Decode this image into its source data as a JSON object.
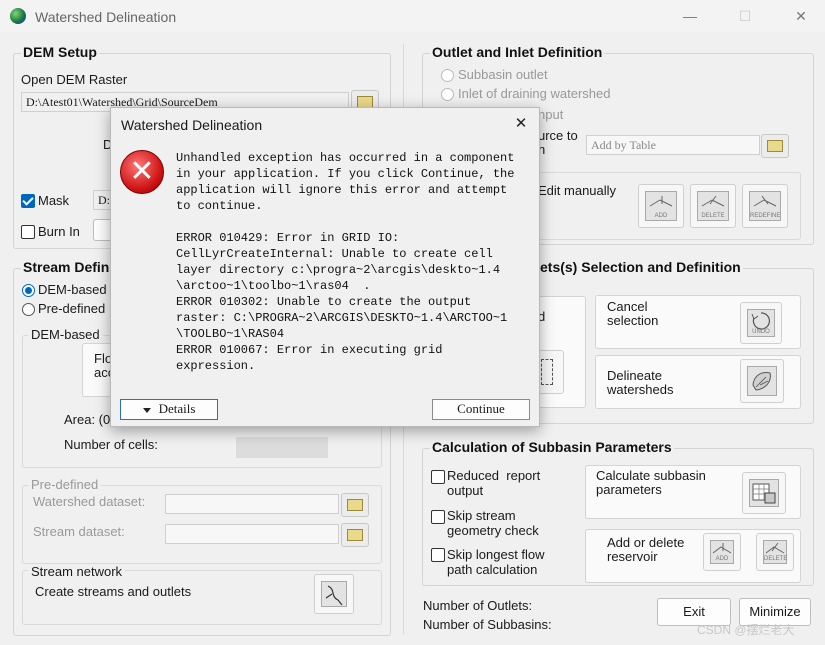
{
  "window": {
    "title": "Watershed Delineation",
    "minimize": "—",
    "maximize": "☐",
    "close": "✕"
  },
  "dem_setup": {
    "header": "DEM Setup",
    "open_dem_label": "Open DEM Raster",
    "dem_path": "D:\\Atest01\\Watershed\\Grid\\SourceDem",
    "partial_label": "D",
    "mask_label": "Mask",
    "mask_checked": true,
    "mask_value": "D:",
    "burn_in_label": "Burn In"
  },
  "stream_definition": {
    "header": "Stream Defin",
    "dem_based_radio": "DEM-based",
    "pre_defined_radio": "Pre-defined",
    "dem_group_label": "DEM-based",
    "flow_acc_partial": "Flo\nacc",
    "area_label": "Area: (0",
    "cells_label": "Number of cells:",
    "predefined_group_label": "Pre-defined",
    "watershed_dataset_label": "Watershed dataset:",
    "stream_dataset_label": "Stream dataset:",
    "stream_network_label": "Stream network",
    "create_streams_label": "Create streams and outlets"
  },
  "outlet": {
    "header": "Outlet and Inlet Definition",
    "subbasin_outlet": "Subbasin outlet",
    "inlet_draining": "Inlet of draining watershed",
    "partial_nput": "nput",
    "source_to_partial": "urce to\nn",
    "add_by_table_placeholder": "Add by Table",
    "edit_manually_partial": "Edit manually",
    "add_label": "ADD",
    "delete_label": "DELETE",
    "redefine_label": "REDEFINE"
  },
  "outlets_selection": {
    "header_partial": "ets(s) Selection and Definition",
    "partial_d": "d",
    "cancel_selection": "Cancel\nselection",
    "undo_label": "UNDO",
    "delineate_watersheds": "Delineate\nwatersheds"
  },
  "calc": {
    "header": "Calculation of Subbasin Parameters",
    "reduced_report": "Reduced  report\noutput",
    "skip_stream": "Skip stream\ngeometry check",
    "skip_longest": "Skip longest flow\npath calculation",
    "calculate_btn": "Calculate subbasin\nparameters",
    "add_delete_reservoir": "Add or delete\nreservoir",
    "add_label": "ADD",
    "delete_label": "DELETE"
  },
  "footer": {
    "outlets_label": "Number of Outlets:",
    "subbasins_label": "Number of Subbasins:",
    "exit_btn": "Exit",
    "minimize_btn": "Minimize",
    "watermark": "CSDN @摆烂老大"
  },
  "dialog": {
    "title": "Watershed Delineation",
    "close": "✕",
    "message1": "Unhandled exception has occurred in a component\nin your application. If you click Continue, the\napplication will ignore this error and attempt\nto continue.",
    "message2": "ERROR 010429: Error in GRID IO:\nCellLyrCreateInternal: Unable to create cell\nlayer directory c:\\progra~2\\arcgis\\deskto~1.4\n\\arctoo~1\\toolbo~1\\ras04  .\nERROR 010302: Unable to create the output\nraster: C:\\PROGRA~2\\ARCGIS\\DESKTO~1.4\\ARCTOO~1\n\\TOOLBO~1\\RAS04\nERROR 010067: Error in executing grid\nexpression.",
    "details_btn": "Details",
    "continue_btn": "Continue"
  }
}
